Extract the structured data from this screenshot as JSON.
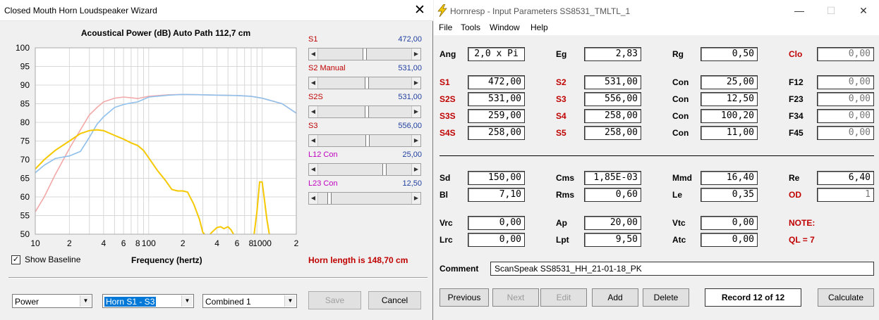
{
  "wizard": {
    "title": "Closed Mouth Horn Loudspeaker Wizard",
    "close_glyph": "✕",
    "sliders": [
      {
        "label": "S1",
        "value": "472,00",
        "color": "#c00000",
        "thumb": 0.5
      },
      {
        "label": "S2 Manual",
        "value": "531,00",
        "color": "#c00000",
        "thumb": 0.52
      },
      {
        "label": "S2S",
        "value": "531,00",
        "color": "#c00000",
        "thumb": 0.52
      },
      {
        "label": "S3",
        "value": "556,00",
        "color": "#c00000",
        "thumb": 0.53
      },
      {
        "label": "L12 Con",
        "value": "25,00",
        "color": "#c000c0",
        "thumb": 0.72
      },
      {
        "label": "L23 Con",
        "value": "12,50",
        "color": "#c000c0",
        "thumb": 0.1
      }
    ],
    "show_baseline": {
      "label": "Show Baseline",
      "checked": true,
      "check_glyph": "✓"
    },
    "frequency_label": "Frequency (hertz)",
    "horn_length": "Horn length is 148,70 cm",
    "combos": {
      "type": "Power",
      "horn": "Horn S1 - S3",
      "mode": "Combined 1"
    },
    "buttons": {
      "save": "Save",
      "cancel": "Cancel"
    }
  },
  "chart_data": {
    "type": "line",
    "title": "Acoustical Power (dB)   Auto Path 112,7 cm",
    "xlabel": "Frequency (hertz)",
    "ylabel": "",
    "x_scale": "log",
    "xlim": [
      10,
      2000
    ],
    "ylim": [
      50,
      100
    ],
    "y_ticks": [
      50,
      55,
      60,
      65,
      70,
      75,
      80,
      85,
      90,
      95,
      100
    ],
    "x_tick_labels": [
      "10",
      "2",
      "4",
      "6",
      "8",
      "100",
      "2",
      "4",
      "6",
      "8",
      "1000",
      "2"
    ],
    "x_tick_values": [
      10,
      20,
      40,
      60,
      80,
      100,
      200,
      400,
      600,
      800,
      1000,
      2000
    ],
    "grid": true,
    "series": [
      {
        "color": "#f4a7a7",
        "x": [
          10,
          12,
          15,
          20,
          25,
          30,
          35,
          40,
          50,
          60,
          70,
          80,
          100,
          150,
          200,
          300,
          400,
          600,
          800,
          1000,
          1500,
          2000
        ],
        "y": [
          56,
          60,
          66,
          73,
          78,
          82,
          84,
          85.5,
          86.5,
          86.8,
          86.6,
          86.4,
          87,
          87.4,
          87.5,
          87.4,
          87.3,
          87.2,
          87,
          86.5,
          85,
          82.5
        ]
      },
      {
        "color": "#8fc0ec",
        "x": [
          10,
          12,
          15,
          20,
          25,
          30,
          35,
          40,
          50,
          60,
          70,
          80,
          100,
          150,
          200,
          300,
          400,
          600,
          800,
          1000,
          1500,
          2000
        ],
        "y": [
          66.5,
          68.5,
          70.3,
          71,
          72.2,
          76,
          79.5,
          81.5,
          84,
          84.8,
          85.2,
          85.5,
          86.8,
          87.3,
          87.5,
          87.4,
          87.3,
          87.2,
          87,
          86.5,
          85,
          82.5
        ]
      },
      {
        "color": "#f5c800",
        "x": [
          10,
          12,
          15,
          20,
          25,
          30,
          35,
          40,
          50,
          60,
          70,
          80,
          90,
          100,
          120,
          140,
          160,
          180,
          200,
          220,
          250,
          280,
          300,
          330,
          360,
          400,
          430,
          460,
          500,
          530,
          560,
          600,
          650,
          700,
          800,
          850,
          900,
          950,
          1000,
          1050,
          1100,
          1200,
          1400,
          1600
        ],
        "y": [
          67.5,
          70,
          72.5,
          75,
          77,
          77.8,
          78,
          77.8,
          76.5,
          75.5,
          74.5,
          73.8,
          72.5,
          70.5,
          67,
          64.5,
          62,
          61.6,
          61.6,
          61.3,
          58,
          54,
          50.5,
          49.2,
          50.5,
          51.8,
          52,
          51.5,
          52,
          51.2,
          50,
          46,
          44.5,
          44,
          46,
          50,
          56,
          64,
          64,
          59,
          54,
          47,
          46,
          45.5
        ]
      }
    ]
  },
  "hornresp": {
    "title": "Hornresp - Input Parameters   SS8531_TMLTL_1",
    "window_controls": {
      "minimize": "—",
      "maximize": "☐",
      "close": "✕"
    },
    "menu": [
      "File",
      "Tools",
      "Window",
      "Help"
    ],
    "params": [
      {
        "label": "Ang",
        "value": "2,0 x Pi",
        "red": false,
        "align": "left"
      },
      {
        "label": "Eg",
        "value": "2,83",
        "red": false
      },
      {
        "label": "Rg",
        "value": "0,50",
        "red": false
      },
      {
        "label": "Clo",
        "value": "0,00",
        "red": true,
        "grey": true
      },
      {
        "label": "S1",
        "value": "472,00",
        "red": true
      },
      {
        "label": "S2",
        "value": "531,00",
        "red": true
      },
      {
        "label": "Con",
        "value": "25,00",
        "red": false
      },
      {
        "label": "F12",
        "value": "0,00",
        "red": false,
        "grey": true
      },
      {
        "label": "S2S",
        "value": "531,00",
        "red": true
      },
      {
        "label": "S3",
        "value": "556,00",
        "red": true
      },
      {
        "label": "Con",
        "value": "12,50",
        "red": false
      },
      {
        "label": "F23",
        "value": "0,00",
        "red": false,
        "grey": true
      },
      {
        "label": "S3S",
        "value": "259,00",
        "red": true
      },
      {
        "label": "S4",
        "value": "258,00",
        "red": true
      },
      {
        "label": "Con",
        "value": "100,20",
        "red": false
      },
      {
        "label": "F34",
        "value": "0,00",
        "red": false,
        "grey": true
      },
      {
        "label": "S4S",
        "value": "258,00",
        "red": true
      },
      {
        "label": "S5",
        "value": "258,00",
        "red": true
      },
      {
        "label": "Con",
        "value": "11,00",
        "red": false
      },
      {
        "label": "F45",
        "value": "0,00",
        "red": false,
        "grey": true
      },
      {
        "label": "Sd",
        "value": "150,00",
        "red": false
      },
      {
        "label": "Cms",
        "value": "1,85E-03",
        "red": false
      },
      {
        "label": "Mmd",
        "value": "16,40",
        "red": false
      },
      {
        "label": "Re",
        "value": "6,40",
        "red": false
      },
      {
        "label": "Bl",
        "value": "7,10",
        "red": false
      },
      {
        "label": "Rms",
        "value": "0,60",
        "red": false
      },
      {
        "label": "Le",
        "value": "0,35",
        "red": false
      },
      {
        "label": "OD",
        "value": "1",
        "red": true,
        "grey": true
      },
      {
        "label": "Vrc",
        "value": "0,00",
        "red": false
      },
      {
        "label": "Ap",
        "value": "20,00",
        "red": false
      },
      {
        "label": "Vtc",
        "value": "0,00",
        "red": false
      },
      {
        "label": "NOTE:",
        "value": "",
        "red": true,
        "nobox": true
      },
      {
        "label": "Lrc",
        "value": "0,00",
        "red": false
      },
      {
        "label": "Lpt",
        "value": "9,50",
        "red": false
      },
      {
        "label": "Atc",
        "value": "0,00",
        "red": false
      },
      {
        "label": "QL = 7",
        "value": "",
        "red": true,
        "nobox": true
      }
    ],
    "comment_label": "Comment",
    "comment_value": "ScanSpeak SS8531_HH_21-01-18_PK",
    "buttons": {
      "previous": "Previous",
      "next": "Next",
      "edit": "Edit",
      "add": "Add",
      "delete": "Delete",
      "calculate": "Calculate"
    },
    "record": "Record 12 of 12"
  }
}
